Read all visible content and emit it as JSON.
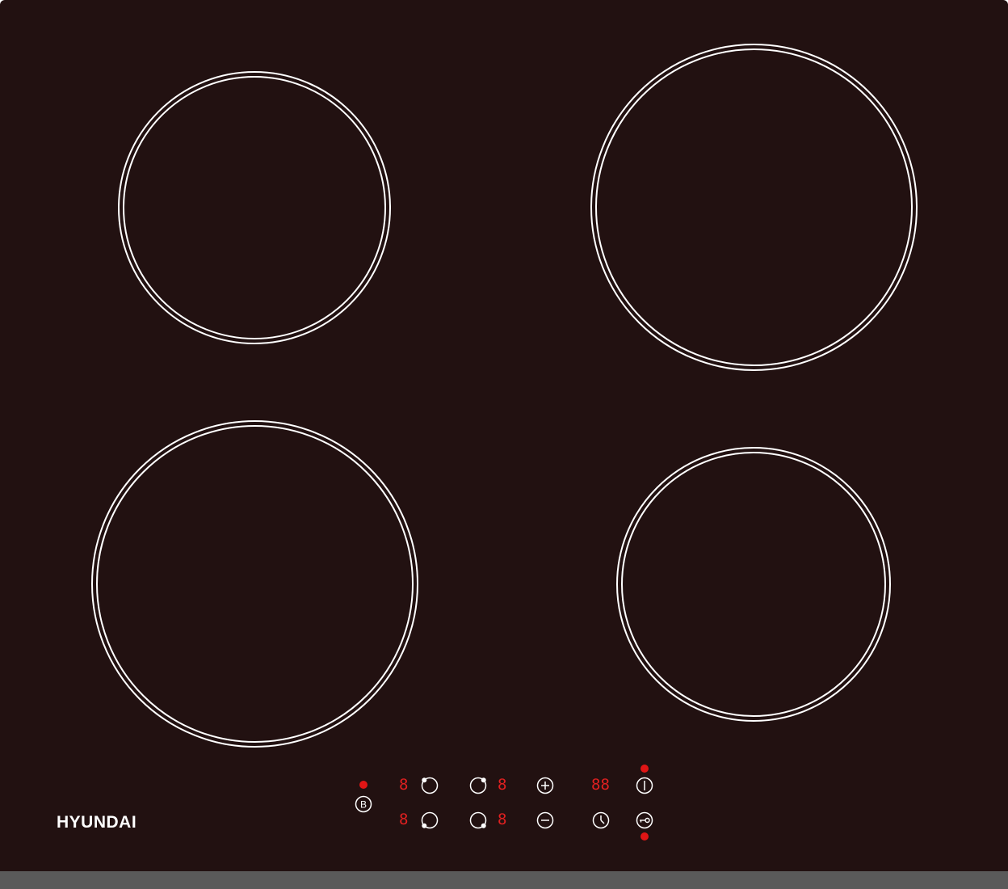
{
  "brand": {
    "name": "HYUNDAI"
  },
  "zones": [
    "rear-left",
    "rear-right",
    "front-left",
    "front-right"
  ],
  "indicators": {
    "b_led": "on",
    "power_led": "on",
    "lock_led": "on"
  },
  "displays": {
    "zone_rear_left": "8",
    "zone_front_left": "8",
    "zone_rear_right": "8",
    "zone_front_right": "8",
    "timer": "88"
  },
  "controls": {
    "boost_label": "B",
    "plus": "+",
    "minus": "−"
  },
  "colors": {
    "glass": "#221111",
    "ring": "#ffffff",
    "indicator": "#e01515",
    "frame": "#5a5a5a"
  }
}
